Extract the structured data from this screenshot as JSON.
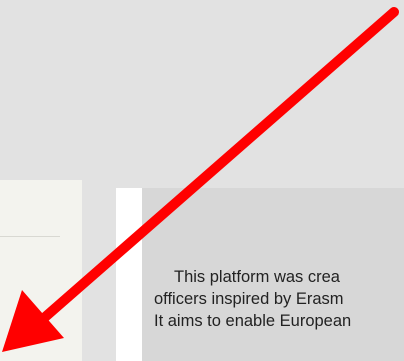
{
  "main": {
    "description_lines": [
      "This platform was crea",
      "officers inspired by Erasm",
      "It aims to enable European"
    ]
  },
  "annotation": {
    "arrow_color": "#ff0000",
    "arrow_icon": "arrow-down-left-icon"
  }
}
